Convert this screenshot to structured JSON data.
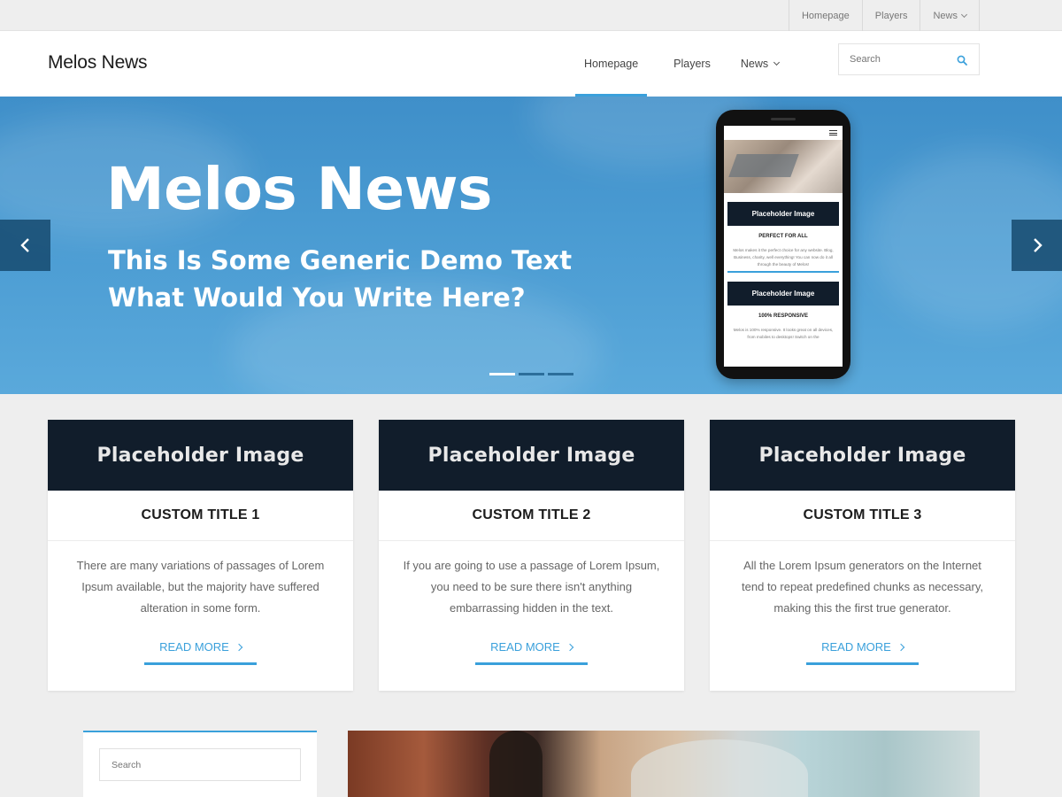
{
  "topbar": {
    "items": [
      {
        "label": "Homepage"
      },
      {
        "label": "Players"
      },
      {
        "label": "News"
      }
    ]
  },
  "header": {
    "site_title": "Melos News",
    "nav": [
      {
        "label": "Homepage",
        "active": true
      },
      {
        "label": "Players"
      },
      {
        "label": "News"
      }
    ],
    "search_placeholder": "Search"
  },
  "hero": {
    "title": "Melos News",
    "subtitle_line1": "This Is Some Generic Demo Text",
    "subtitle_line2": "What Would You Write Here?",
    "active_slide": 1,
    "slide_count": 3,
    "phone": {
      "card1_image": "Placeholder Image",
      "card1_title": "PERFECT FOR ALL",
      "card1_text": "Melos makes it the perfect choice for any website. Blog, Business, charity, well everything! You can now do it all through the beauty of Melos!",
      "card2_image": "Placeholder Image",
      "card2_title": "100% RESPONSIVE",
      "card2_text": "Melos is 100% responsive. It looks great on all devices, from mobiles to desktops! Switch on the"
    }
  },
  "cards": [
    {
      "image_label": "Placeholder Image",
      "title": "CUSTOM TITLE 1",
      "text": "There are many variations of passages of Lorem Ipsum available, but the majority have suffered alteration in some form.",
      "more": "READ MORE"
    },
    {
      "image_label": "Placeholder Image",
      "title": "CUSTOM TITLE 2",
      "text": "If you are going to use a passage of Lorem Ipsum, you need to be sure there isn't anything embarrassing hidden in the text.",
      "more": "READ MORE"
    },
    {
      "image_label": "Placeholder Image",
      "title": "CUSTOM TITLE 3",
      "text": "All the Lorem Ipsum generators on the Internet tend to repeat predefined chunks as necessary, making this the first true generator.",
      "more": "READ MORE"
    }
  ],
  "sidebar": {
    "search_placeholder": "Search"
  },
  "colors": {
    "accent": "#3aa0db",
    "dark": "#111d2b",
    "background": "#eeeeee"
  },
  "icons": {
    "search": "search-icon",
    "prev": "chevron-left-icon",
    "next": "chevron-right-icon",
    "dropdown": "chevron-down-icon",
    "menu": "hamburger-icon"
  }
}
